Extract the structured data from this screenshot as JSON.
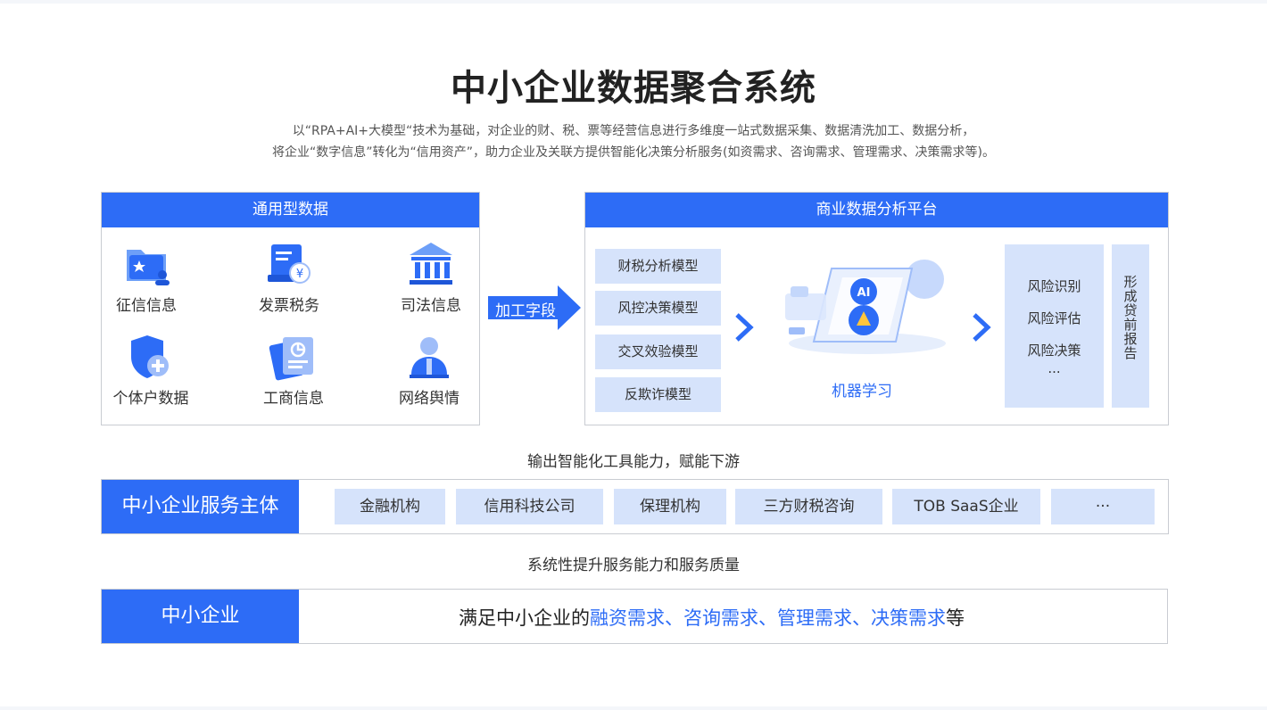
{
  "title": "中小企业数据聚合系统",
  "description": {
    "line1": "以“RPA+AI+大模型“技术为基础，对企业的财、税、票等经营信息进行多维度一站式数据采集、数据清洗加工、数据分析，",
    "line2": "将企业“数字信息”转化为“信用资产”，助力企业及关联方提供智能化决策分析服务(如资需求、咨询需求、管理需求、决策需求等)。"
  },
  "general_data": {
    "header": "通用型数据",
    "items": [
      {
        "label": "征信信息",
        "icon": "credit-folder-icon"
      },
      {
        "label": "发票税务",
        "icon": "invoice-tax-icon"
      },
      {
        "label": "司法信息",
        "icon": "courthouse-icon"
      },
      {
        "label": "个体户数据",
        "icon": "shield-plus-icon"
      },
      {
        "label": "工商信息",
        "icon": "business-document-icon"
      },
      {
        "label": "网络舆情",
        "icon": "person-opinion-icon"
      }
    ]
  },
  "process_arrow": "加工字段",
  "platform": {
    "header": "商业数据分析平台",
    "models": [
      "财税分析模型",
      "风控决策模型",
      "交叉效验模型",
      "反欺诈模型"
    ],
    "ml_label": "机器学习",
    "risks": [
      "风险识别",
      "风险评估",
      "风险决策",
      "..."
    ],
    "report": [
      "形",
      "成",
      "贷",
      "前",
      "报",
      "告"
    ]
  },
  "caption1": "输出智能化工具能力，赋能下游",
  "service": {
    "header": "中小企业服务主体",
    "chips": [
      "金融机构",
      "信用科技公司",
      "保理机构",
      "三方财税咨询",
      "TOB SaaS企业",
      "···"
    ]
  },
  "caption2": "系统性提升服务能力和服务质量",
  "sme": {
    "header": "中小企业",
    "prefix": "满足中小企业的",
    "needs": [
      "融资需求",
      "咨询需求",
      "管理需求",
      "决策需求"
    ],
    "separator": "、",
    "suffix": "等"
  },
  "colors": {
    "primary": "#2d6cf6",
    "chip": "#d6e3fb",
    "border": "#c9ccd2"
  }
}
